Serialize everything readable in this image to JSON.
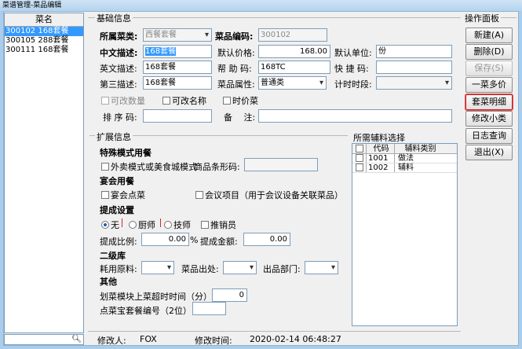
{
  "window": {
    "title": "菜谱管理-菜品编辑"
  },
  "dish_list": {
    "header": "菜名",
    "items": [
      {
        "label": "300102 168套餐"
      },
      {
        "label": "300105 288套餐"
      },
      {
        "label": "300111 168套餐"
      }
    ],
    "search_placeholder": "",
    "search_icon": "magnifier"
  },
  "basic": {
    "section_title": "基础信息",
    "category_label": "所属菜类:",
    "category_value": "西餐套餐",
    "code_label": "菜品编码:",
    "code_value": "300102",
    "cn_label": "中文描述:",
    "cn_value": "168套餐",
    "price_label": "默认价格:",
    "price_value": "168.00",
    "unit_label": "默认单位:",
    "unit_value": "份",
    "en_label": "英文描述:",
    "en_value": "168套餐",
    "help_label": "帮 助 码:",
    "help_value": "168TC",
    "quick_label": "快 捷 码:",
    "quick_value": "",
    "third_label": "第三描述:",
    "third_value": "168套餐",
    "attr_label": "菜品属性:",
    "attr_value": "普通类",
    "period_label": "计时时段:",
    "period_value": "",
    "chk_qty": "可改数量",
    "chk_name": "可改名称",
    "chk_timeprice": "时价菜",
    "sort_label": "排 序 码:",
    "sort_value": "",
    "note_label": "备　 注:",
    "note_value": ""
  },
  "ext": {
    "section_title": "扩展信息",
    "special_title": "特殊模式用餐",
    "takeout_label": "外卖模式或美食城模式",
    "barcode_label": "商品条形码:",
    "barcode_value": "",
    "banquet_title": "宴会用餐",
    "banquet_order": "宴会点菜",
    "meeting_item": "会议项目（用于会议设备关联菜品）",
    "commission_title": "提成设置",
    "radio_none": "无",
    "radio_chef": "厨师",
    "radio_tech": "技师",
    "chk_sales": "推销员",
    "ratio_label": "提成比例:",
    "ratio_value": "0.00",
    "ratio_unit": "%",
    "amount_label": "提成金额:",
    "amount_value": "0.00",
    "warehouse_title": "二级库",
    "material_label": "耗用原料:",
    "outlet_label": "菜品出处:",
    "dept_label": "出品部门:",
    "other_title": "其他",
    "timeout_label": "划菜模块上菜超时时间（分）:",
    "timeout_value": "0",
    "set_no_label": "点菜宝套餐编号（2位）:",
    "set_no_value": ""
  },
  "aux": {
    "title": "所需辅料选择",
    "columns": [
      "代码",
      "辅料类别"
    ],
    "rows": [
      {
        "code": "1001",
        "type": "做法"
      },
      {
        "code": "1002",
        "type": "辅料"
      }
    ]
  },
  "ops": {
    "title": "操作面板",
    "buttons": [
      {
        "label": "新建(A)"
      },
      {
        "label": "删除(D)"
      },
      {
        "label": "保存(S)"
      },
      {
        "label": "一菜多价"
      },
      {
        "label": "套菜明细"
      },
      {
        "label": "修改小类"
      },
      {
        "label": "日志查询"
      },
      {
        "label": "退出(X)"
      }
    ]
  },
  "footer": {
    "modifier_label": "修改人:",
    "modifier_value": "FOX",
    "time_label": "修改时间:",
    "time_value": "2020-02-14 06:48:27"
  }
}
